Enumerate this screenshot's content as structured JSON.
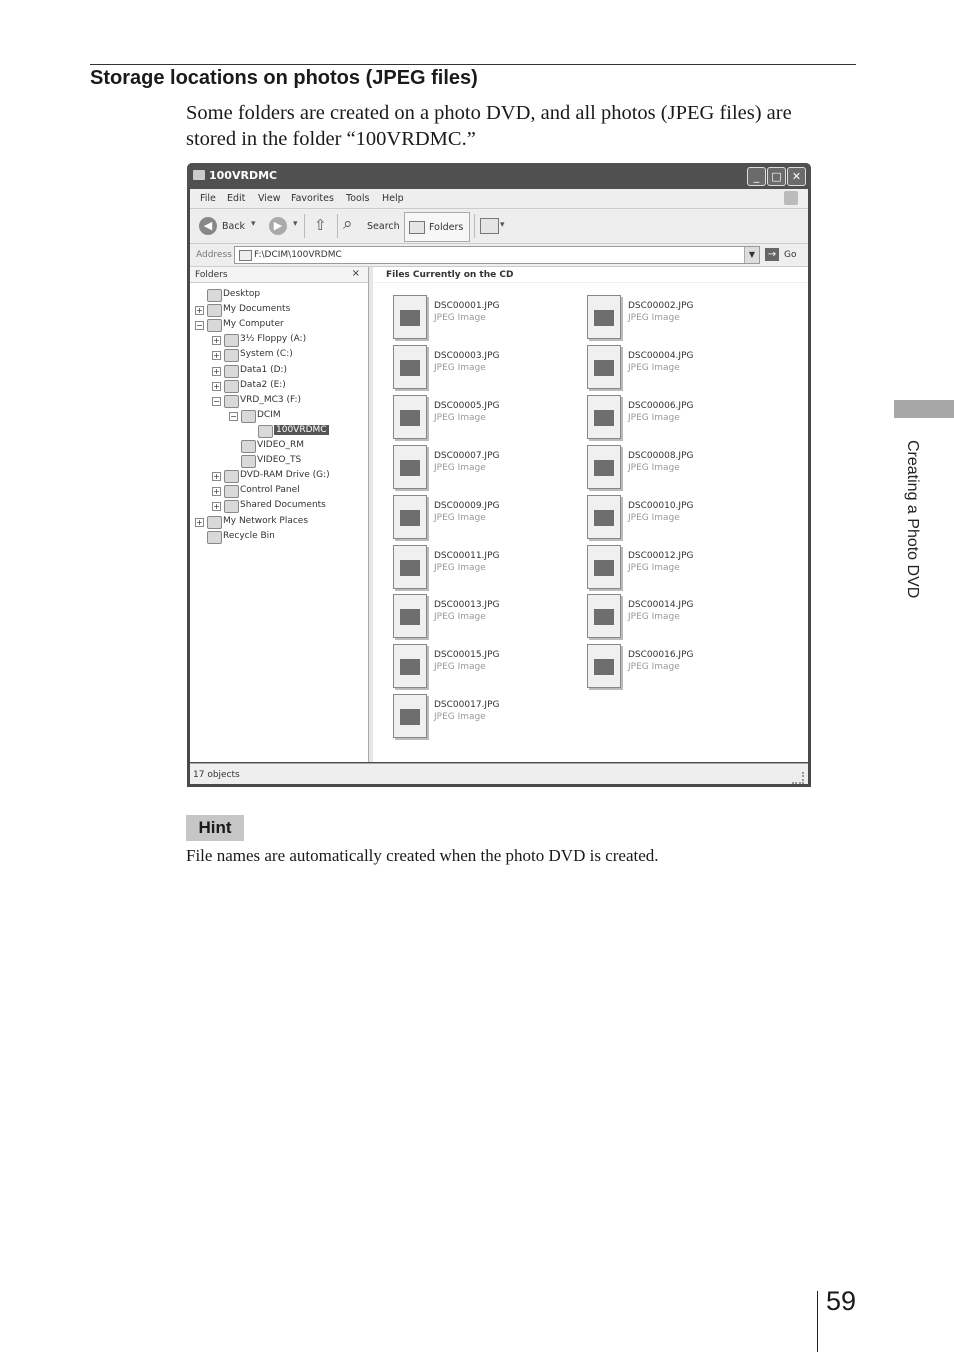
{
  "section": {
    "heading": "Storage locations on photos (JPEG files)",
    "intro": "Some folders are created on a photo DVD, and all photos (JPEG files) are stored in the folder “100VRDMC.”"
  },
  "explorer": {
    "title": "100VRDMC",
    "menu": [
      "File",
      "Edit",
      "View",
      "Favorites",
      "Tools",
      "Help"
    ],
    "toolbar": {
      "back": "Back",
      "search": "Search",
      "folders": "Folders"
    },
    "address": {
      "label": "Address",
      "path": "F:\\DCIM\\100VRDMC",
      "go": "Go"
    },
    "folders_pane": {
      "title": "Folders",
      "close": "×",
      "tree": [
        {
          "label": "Desktop",
          "expander": "",
          "icon": "desktop-icon"
        },
        {
          "label": "My Documents",
          "expander": "+",
          "icon": "my-documents-icon"
        },
        {
          "label": "My Computer",
          "expander": "−",
          "icon": "my-computer-icon"
        },
        {
          "label": "3½ Floppy (A:)",
          "expander": "+",
          "icon": "floppy-icon"
        },
        {
          "label": "System (C:)",
          "expander": "+",
          "icon": "drive-icon"
        },
        {
          "label": "Data1 (D:)",
          "expander": "+",
          "icon": "drive-icon"
        },
        {
          "label": "Data2 (E:)",
          "expander": "+",
          "icon": "drive-icon"
        },
        {
          "label": "VRD_MC3 (F:)",
          "expander": "−",
          "icon": "dvd-icon"
        },
        {
          "label": "DCIM",
          "expander": "−",
          "icon": "folder-icon"
        },
        {
          "label": "100VRDMC",
          "expander": "",
          "icon": "folder-icon",
          "selected": true
        },
        {
          "label": "VIDEO_RM",
          "expander": "",
          "icon": "folder-icon"
        },
        {
          "label": "VIDEO_TS",
          "expander": "",
          "icon": "folder-icon"
        },
        {
          "label": "DVD-RAM Drive (G:)",
          "expander": "+",
          "icon": "dvd-ram-icon"
        },
        {
          "label": "Control Panel",
          "expander": "+",
          "icon": "control-panel-icon"
        },
        {
          "label": "Shared Documents",
          "expander": "+",
          "icon": "folder-icon"
        },
        {
          "label": "My Network Places",
          "expander": "+",
          "icon": "network-icon"
        },
        {
          "label": "Recycle Bin",
          "expander": "",
          "icon": "recycle-bin-icon"
        }
      ]
    },
    "files_pane": {
      "title": "Files Currently on the CD",
      "files": [
        {
          "name": "DSC00001.JPG",
          "type": "JPEG Image"
        },
        {
          "name": "DSC00002.JPG",
          "type": "JPEG Image"
        },
        {
          "name": "DSC00003.JPG",
          "type": "JPEG Image"
        },
        {
          "name": "DSC00004.JPG",
          "type": "JPEG Image"
        },
        {
          "name": "DSC00005.JPG",
          "type": "JPEG Image"
        },
        {
          "name": "DSC00006.JPG",
          "type": "JPEG Image"
        },
        {
          "name": "DSC00007.JPG",
          "type": "JPEG Image"
        },
        {
          "name": "DSC00008.JPG",
          "type": "JPEG Image"
        },
        {
          "name": "DSC00009.JPG",
          "type": "JPEG Image"
        },
        {
          "name": "DSC00010.JPG",
          "type": "JPEG Image"
        },
        {
          "name": "DSC00011.JPG",
          "type": "JPEG Image"
        },
        {
          "name": "DSC00012.JPG",
          "type": "JPEG Image"
        },
        {
          "name": "DSC00013.JPG",
          "type": "JPEG Image"
        },
        {
          "name": "DSC00014.JPG",
          "type": "JPEG Image"
        },
        {
          "name": "DSC00015.JPG",
          "type": "JPEG Image"
        },
        {
          "name": "DSC00016.JPG",
          "type": "JPEG Image"
        },
        {
          "name": "DSC00017.JPG",
          "type": "JPEG Image"
        }
      ]
    },
    "status": "17 objects"
  },
  "hint": {
    "label": "Hint",
    "text": "File names are automatically created when the photo DVD is created."
  },
  "side_tab": "Creating a Photo DVD",
  "page_number": "59"
}
